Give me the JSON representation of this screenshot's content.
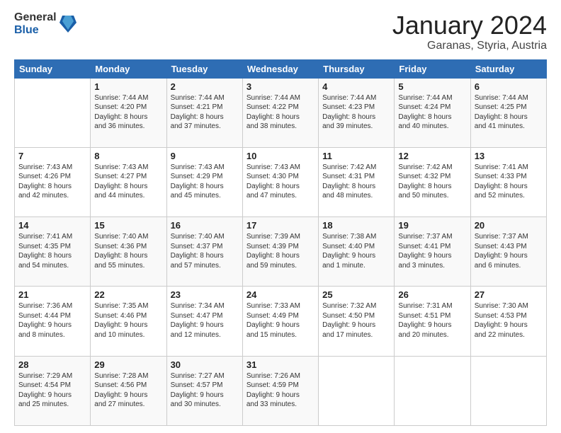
{
  "logo": {
    "general": "General",
    "blue": "Blue"
  },
  "header": {
    "month": "January 2024",
    "location": "Garanas, Styria, Austria"
  },
  "weekdays": [
    "Sunday",
    "Monday",
    "Tuesday",
    "Wednesday",
    "Thursday",
    "Friday",
    "Saturday"
  ],
  "weeks": [
    [
      {
        "day": "",
        "content": ""
      },
      {
        "day": "1",
        "content": "Sunrise: 7:44 AM\nSunset: 4:20 PM\nDaylight: 8 hours\nand 36 minutes."
      },
      {
        "day": "2",
        "content": "Sunrise: 7:44 AM\nSunset: 4:21 PM\nDaylight: 8 hours\nand 37 minutes."
      },
      {
        "day": "3",
        "content": "Sunrise: 7:44 AM\nSunset: 4:22 PM\nDaylight: 8 hours\nand 38 minutes."
      },
      {
        "day": "4",
        "content": "Sunrise: 7:44 AM\nSunset: 4:23 PM\nDaylight: 8 hours\nand 39 minutes."
      },
      {
        "day": "5",
        "content": "Sunrise: 7:44 AM\nSunset: 4:24 PM\nDaylight: 8 hours\nand 40 minutes."
      },
      {
        "day": "6",
        "content": "Sunrise: 7:44 AM\nSunset: 4:25 PM\nDaylight: 8 hours\nand 41 minutes."
      }
    ],
    [
      {
        "day": "7",
        "content": "Sunrise: 7:43 AM\nSunset: 4:26 PM\nDaylight: 8 hours\nand 42 minutes."
      },
      {
        "day": "8",
        "content": "Sunrise: 7:43 AM\nSunset: 4:27 PM\nDaylight: 8 hours\nand 44 minutes."
      },
      {
        "day": "9",
        "content": "Sunrise: 7:43 AM\nSunset: 4:29 PM\nDaylight: 8 hours\nand 45 minutes."
      },
      {
        "day": "10",
        "content": "Sunrise: 7:43 AM\nSunset: 4:30 PM\nDaylight: 8 hours\nand 47 minutes."
      },
      {
        "day": "11",
        "content": "Sunrise: 7:42 AM\nSunset: 4:31 PM\nDaylight: 8 hours\nand 48 minutes."
      },
      {
        "day": "12",
        "content": "Sunrise: 7:42 AM\nSunset: 4:32 PM\nDaylight: 8 hours\nand 50 minutes."
      },
      {
        "day": "13",
        "content": "Sunrise: 7:41 AM\nSunset: 4:33 PM\nDaylight: 8 hours\nand 52 minutes."
      }
    ],
    [
      {
        "day": "14",
        "content": "Sunrise: 7:41 AM\nSunset: 4:35 PM\nDaylight: 8 hours\nand 54 minutes."
      },
      {
        "day": "15",
        "content": "Sunrise: 7:40 AM\nSunset: 4:36 PM\nDaylight: 8 hours\nand 55 minutes."
      },
      {
        "day": "16",
        "content": "Sunrise: 7:40 AM\nSunset: 4:37 PM\nDaylight: 8 hours\nand 57 minutes."
      },
      {
        "day": "17",
        "content": "Sunrise: 7:39 AM\nSunset: 4:39 PM\nDaylight: 8 hours\nand 59 minutes."
      },
      {
        "day": "18",
        "content": "Sunrise: 7:38 AM\nSunset: 4:40 PM\nDaylight: 9 hours\nand 1 minute."
      },
      {
        "day": "19",
        "content": "Sunrise: 7:37 AM\nSunset: 4:41 PM\nDaylight: 9 hours\nand 3 minutes."
      },
      {
        "day": "20",
        "content": "Sunrise: 7:37 AM\nSunset: 4:43 PM\nDaylight: 9 hours\nand 6 minutes."
      }
    ],
    [
      {
        "day": "21",
        "content": "Sunrise: 7:36 AM\nSunset: 4:44 PM\nDaylight: 9 hours\nand 8 minutes."
      },
      {
        "day": "22",
        "content": "Sunrise: 7:35 AM\nSunset: 4:46 PM\nDaylight: 9 hours\nand 10 minutes."
      },
      {
        "day": "23",
        "content": "Sunrise: 7:34 AM\nSunset: 4:47 PM\nDaylight: 9 hours\nand 12 minutes."
      },
      {
        "day": "24",
        "content": "Sunrise: 7:33 AM\nSunset: 4:49 PM\nDaylight: 9 hours\nand 15 minutes."
      },
      {
        "day": "25",
        "content": "Sunrise: 7:32 AM\nSunset: 4:50 PM\nDaylight: 9 hours\nand 17 minutes."
      },
      {
        "day": "26",
        "content": "Sunrise: 7:31 AM\nSunset: 4:51 PM\nDaylight: 9 hours\nand 20 minutes."
      },
      {
        "day": "27",
        "content": "Sunrise: 7:30 AM\nSunset: 4:53 PM\nDaylight: 9 hours\nand 22 minutes."
      }
    ],
    [
      {
        "day": "28",
        "content": "Sunrise: 7:29 AM\nSunset: 4:54 PM\nDaylight: 9 hours\nand 25 minutes."
      },
      {
        "day": "29",
        "content": "Sunrise: 7:28 AM\nSunset: 4:56 PM\nDaylight: 9 hours\nand 27 minutes."
      },
      {
        "day": "30",
        "content": "Sunrise: 7:27 AM\nSunset: 4:57 PM\nDaylight: 9 hours\nand 30 minutes."
      },
      {
        "day": "31",
        "content": "Sunrise: 7:26 AM\nSunset: 4:59 PM\nDaylight: 9 hours\nand 33 minutes."
      },
      {
        "day": "",
        "content": ""
      },
      {
        "day": "",
        "content": ""
      },
      {
        "day": "",
        "content": ""
      }
    ]
  ]
}
